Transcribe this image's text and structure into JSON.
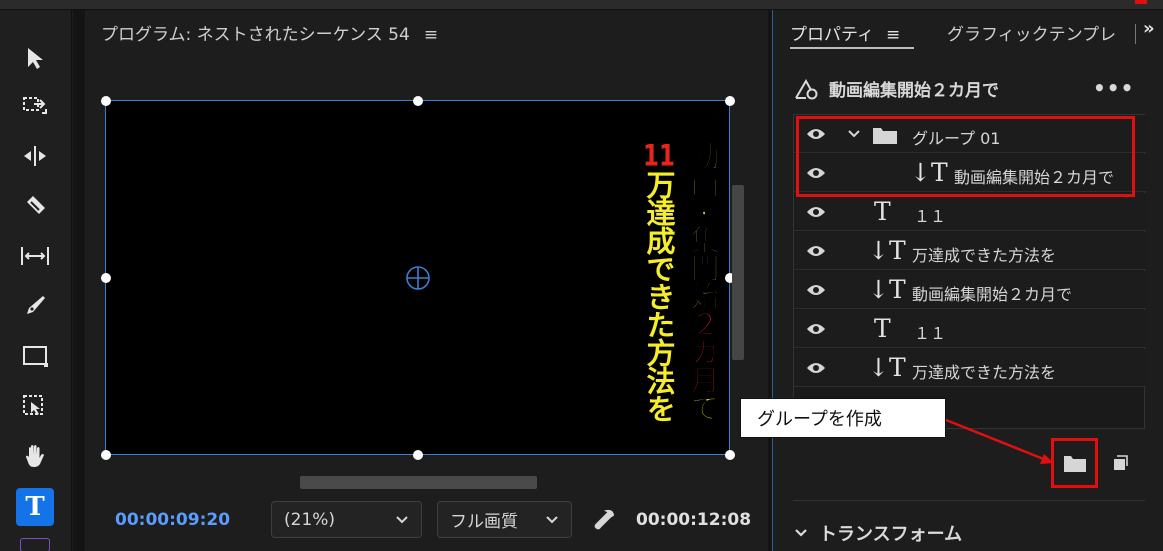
{
  "program": {
    "title": "プログラム: ネストされたシーケンス 54",
    "menu_icon": "≡",
    "current_time": "00:00:09:20",
    "zoom": "(21%)",
    "quality": "フル画質",
    "duration": "00:00:12:08"
  },
  "canvas_text": {
    "col1_a": "動画編集開始",
    "col1_b": "２カ月",
    "col1_c": "で",
    "col2_a": "11",
    "col2_b": "万達成できた方法を"
  },
  "panel": {
    "tab_properties": "プロパティ",
    "tab_menu": "≡",
    "tab_graphic": "グラフィックテンプレ",
    "tab_more": "»",
    "title": "動画編集開始２カ月で",
    "more": "•••"
  },
  "layers": [
    {
      "icon": "",
      "label": "グループ 01"
    },
    {
      "icon": "↓T",
      "label": "動画編集開始２カ月で"
    },
    {
      "icon": "T",
      "label": "１１"
    },
    {
      "icon": "↓T",
      "label": "万達成できた方法を"
    },
    {
      "icon": "↓T",
      "label": "動画編集開始２カ月で"
    },
    {
      "icon": "T",
      "label": "１１"
    },
    {
      "icon": "↓T",
      "label": "万達成できた方法を"
    }
  ],
  "callout": {
    "text": "グループを作成"
  },
  "transform": {
    "label": "トランスフォーム"
  },
  "colors": {
    "accent": "#1473e6",
    "highlight": "#e01010",
    "title_yellow": "#f5ec2c",
    "title_red": "#e8241b",
    "timecode_blue": "#5b9cff"
  }
}
